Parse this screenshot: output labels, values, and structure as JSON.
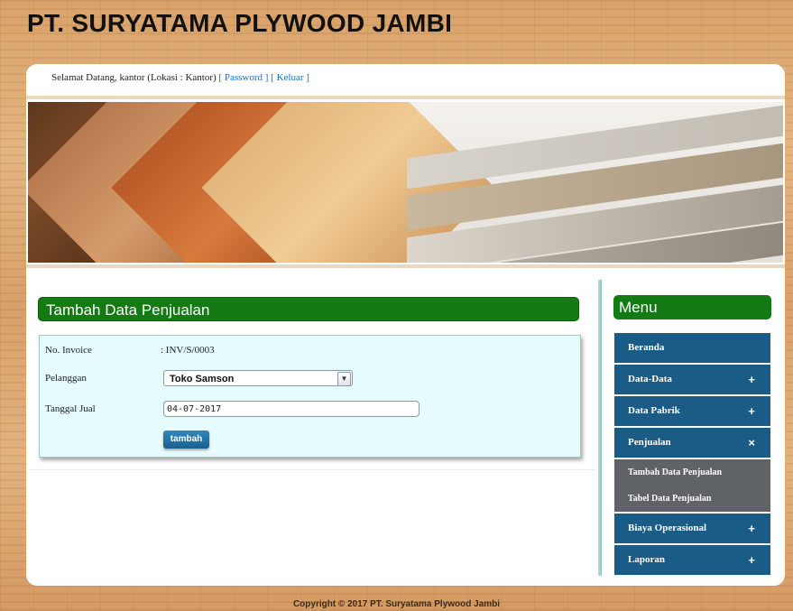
{
  "site": {
    "title": "PT. SURYATAMA PLYWOOD JAMBI"
  },
  "welcome": {
    "text": "Selamat Datang, kantor (Lokasi : Kantor)",
    "password_link": "[ Password ]",
    "logout_link": "[ Keluar ]"
  },
  "form": {
    "title": "Tambah Data Penjualan",
    "invoice_label": "No. Invoice",
    "invoice_value": ": INV/S/0003",
    "customer_label": "Pelanggan",
    "customer_selected": "Toko Samson",
    "date_label": "Tanggal Jual",
    "date_value": "04-07-2017",
    "submit_label": "tambah"
  },
  "menu": {
    "title": "Menu",
    "items": [
      {
        "label": "Beranda",
        "sign": ""
      },
      {
        "label": "Data-Data",
        "sign": "+"
      },
      {
        "label": "Data Pabrik",
        "sign": "+"
      },
      {
        "label": "Penjualan",
        "sign": "×"
      },
      {
        "label": "Biaya Operasional",
        "sign": "+"
      },
      {
        "label": "Laporan",
        "sign": "+"
      }
    ],
    "sub_items": [
      {
        "label": "Tambah Data Penjualan"
      },
      {
        "label": "Tabel Data Penjualan"
      }
    ]
  },
  "footer": {
    "text": "Copyright © 2017 PT. Suryatama Plywood Jambi"
  }
}
